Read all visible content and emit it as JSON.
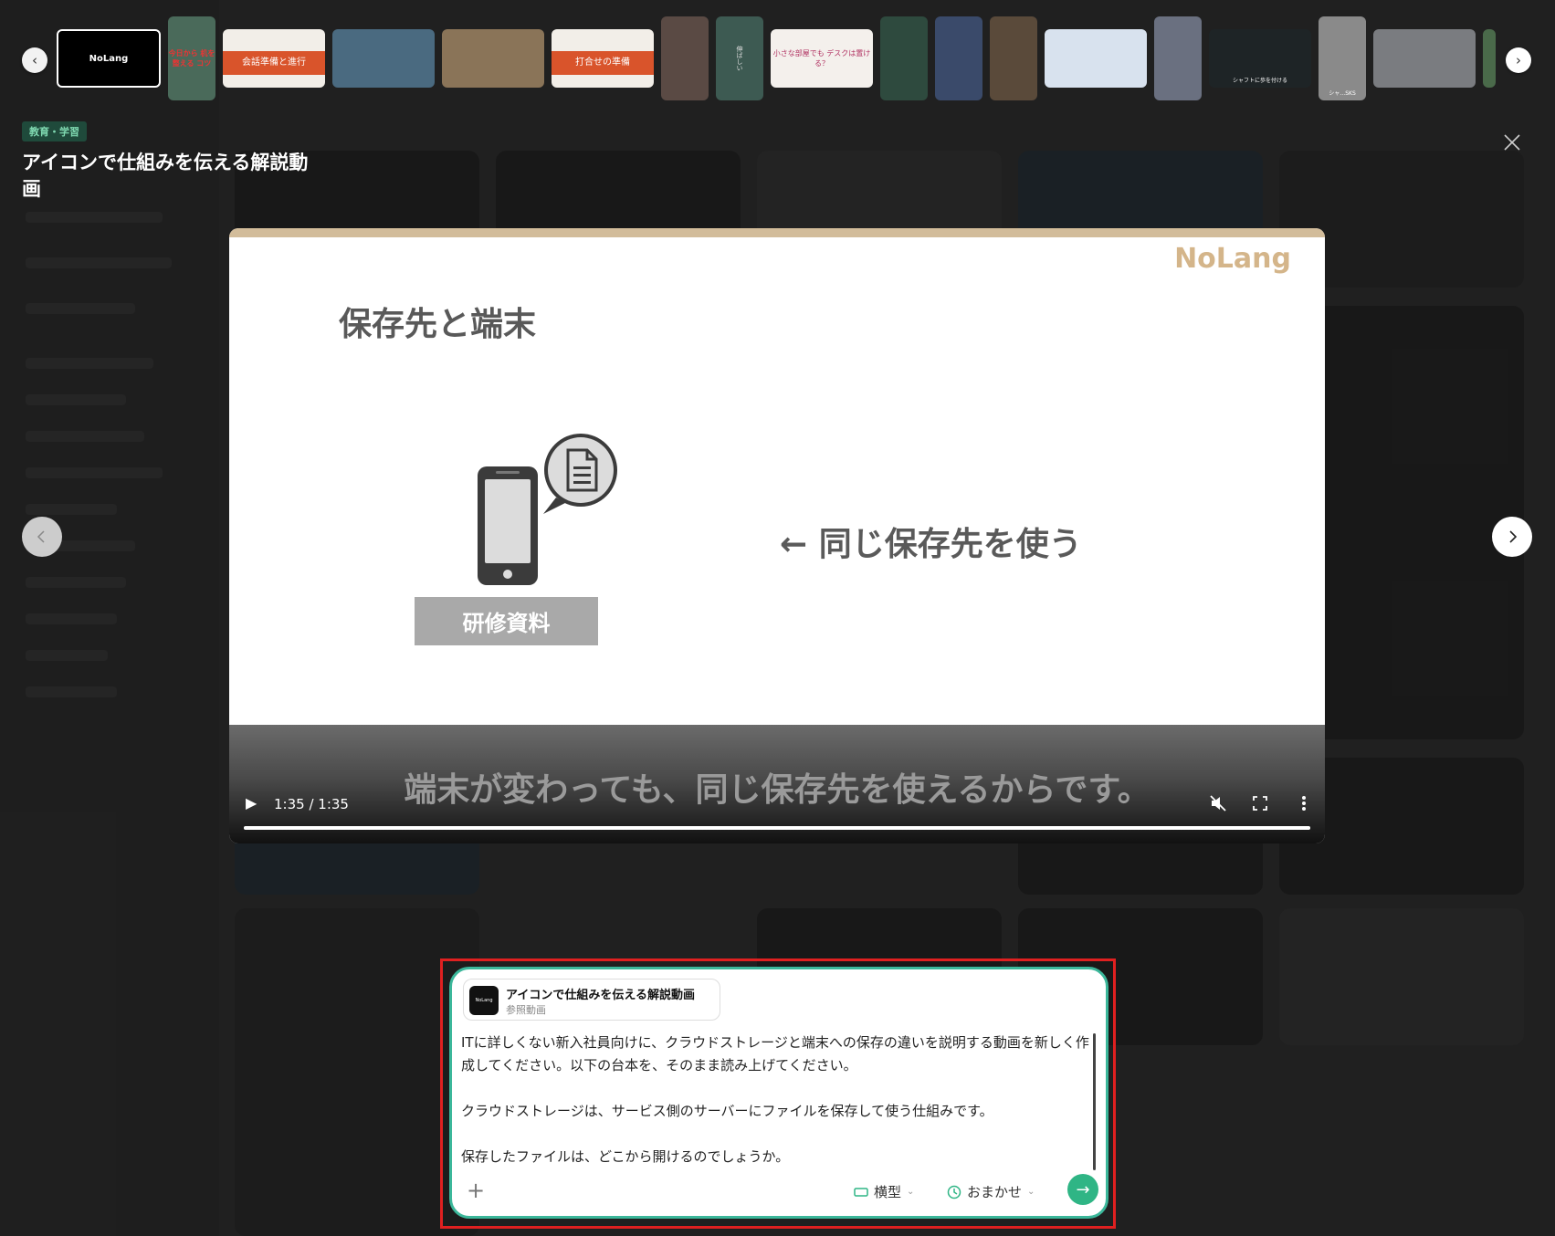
{
  "header": {
    "category": "教育・学習",
    "title": "アイコンで仕組みを伝える解説動画"
  },
  "thumbnails": [
    {
      "label": "NoLang",
      "selected": true
    },
    {
      "label": "今日から 机を 整える コツ"
    },
    {
      "label": "会話準備と進行"
    },
    {
      "label": ""
    },
    {
      "label": ""
    },
    {
      "label": "打合せの準備"
    },
    {
      "label": ""
    },
    {
      "label": "伸ばしい"
    },
    {
      "label": "小さな部屋でも デスクは置ける？"
    },
    {
      "label": ""
    },
    {
      "label": ""
    },
    {
      "label": ""
    },
    {
      "label": ""
    },
    {
      "label": ""
    },
    {
      "label": "シャフトに歩を付ける"
    },
    {
      "label": "シャ…SKS"
    },
    {
      "label": ""
    }
  ],
  "player": {
    "brand": "NoLang",
    "slide_heading": "保存先と端末",
    "caption_box": "研修資料",
    "arrow_text": "← 同じ保存先を使う",
    "subtitle": "端末が変わっても、同じ保存先を使えるからです。",
    "time": "1:35 / 1:35",
    "progress": 1.0
  },
  "prompt": {
    "ref_title": "アイコンで仕組みを伝える解説動画",
    "ref_sub": "参照動画",
    "ref_thumb_label": "NoLang",
    "text": [
      "ITに詳しくない新入社員向けに、クラウドストレージと端末への保存の違いを説明する動画を新しく作成してください。以下の台本を、そのまま読み上げてください。",
      "クラウドストレージは、サービス側のサーバーにファイルを保存して使う仕組みです。",
      "保存したファイルは、どこから開けるのでしょうか。"
    ],
    "orientation": "横型",
    "duration": "おまかせ",
    "accent_color": "#2fb585"
  },
  "colors": {
    "highlight": "#e02020",
    "category_text": "#7fd8b0",
    "brand": "#d4b58a"
  }
}
